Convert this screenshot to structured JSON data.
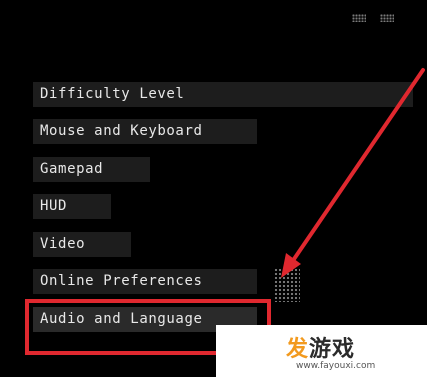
{
  "menu": {
    "items": [
      {
        "label": "Difficulty Level"
      },
      {
        "label": "Mouse and Keyboard"
      },
      {
        "label": "Gamepad"
      },
      {
        "label": "HUD"
      },
      {
        "label": "Video"
      },
      {
        "label": "Online Preferences"
      },
      {
        "label": "Audio and Language"
      }
    ],
    "highlighted_item": "Audio and Language"
  },
  "annotation": {
    "box_color": "#e0282f",
    "arrow_color": "#e0282f"
  },
  "watermark": {
    "logo_part1": "发",
    "logo_part2": "游戏",
    "url": "www.fayouxi.com",
    "accent_color": "#f29a1f"
  }
}
